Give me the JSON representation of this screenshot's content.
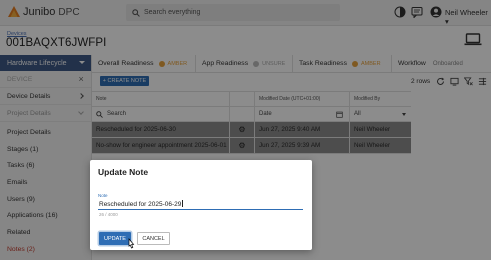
{
  "app": {
    "brand": "Junibo",
    "product": "DPC"
  },
  "search": {
    "placeholder": "Search everything"
  },
  "user": {
    "name": "Neil Wheeler"
  },
  "breadcrumb": {
    "label": "Devices"
  },
  "record": {
    "title": "001BAQXT6JWFPI"
  },
  "sidebar": {
    "lifecycle_label": "Hardware Lifecycle",
    "device_label": "DEVICE",
    "details_label": "Device Details",
    "project_details_label": "Project Details",
    "links": [
      {
        "label": "Project Details"
      },
      {
        "label": "Stages (1)"
      },
      {
        "label": "Tasks (6)"
      },
      {
        "label": "Emails"
      },
      {
        "label": "Users (9)"
      },
      {
        "label": "Applications (16)"
      },
      {
        "label": "Related"
      },
      {
        "label": "Notes (2)"
      }
    ]
  },
  "tabs": [
    {
      "label": "Overall Readiness",
      "status": "AMBER"
    },
    {
      "label": "App Readiness",
      "status": "UNSURE"
    },
    {
      "label": "Task Readiness",
      "status": "AMBER"
    },
    {
      "label": "Workflow",
      "status": "Onboarded"
    }
  ],
  "colors": {
    "amber": "#e8a33d",
    "unsure": "#bdbdbd",
    "primary": "#2e6db4",
    "lifecycle": "#3f5a87",
    "active_link": "#c0392b"
  },
  "toolbar": {
    "create_label": "+ CREATE NOTE",
    "rows_count": "2 rows"
  },
  "table": {
    "headers": {
      "note": "Note",
      "modified_date": "Modified Date (UTC+01:00)",
      "modified_by": "Modified By"
    },
    "filters": {
      "search_placeholder": "Search",
      "date_placeholder": "Date",
      "modified_by_value": "All"
    },
    "rows": [
      {
        "note": "Rescheduled for 2025-06-30",
        "date": "Jun 27, 2025 9:40 AM",
        "by": "Neil Wheeler"
      },
      {
        "note": "No-show for engineer appointment 2025-06-01",
        "date": "Jun 27, 2025 9:39 AM",
        "by": "Neil Wheeler"
      }
    ]
  },
  "dialog": {
    "title": "Update Note",
    "field_label": "Note",
    "value": "Rescheduled for 2025-06-29",
    "counter": "26 / 4000",
    "update_label": "UPDATE",
    "cancel_label": "CANCEL"
  }
}
